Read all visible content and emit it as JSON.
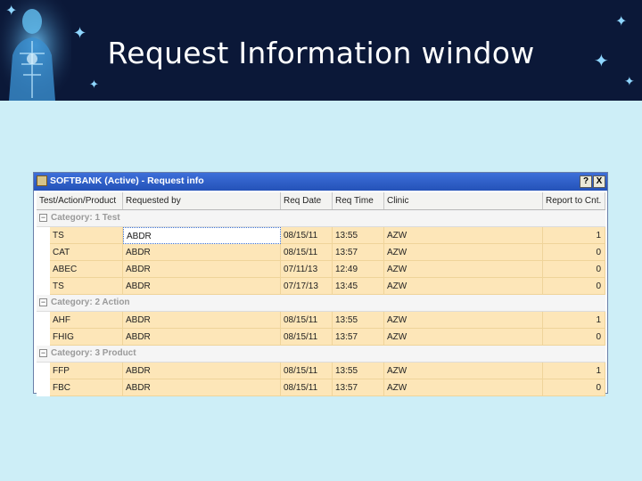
{
  "slide": {
    "title": "Request Information window"
  },
  "window": {
    "title": "SOFTBANK (Active) - Request info",
    "help_label": "?",
    "close_label": "X"
  },
  "table": {
    "columns": [
      "Test/Action/Product",
      "Requested by",
      "Req Date",
      "Req Time",
      "Clinic",
      "Report to Cnt."
    ],
    "groups": [
      {
        "label": "Category: 1 Test",
        "rows": [
          [
            "TS",
            "ABDR",
            "08/15/11",
            "13:55",
            "AZW",
            "1"
          ],
          [
            "CAT",
            "ABDR",
            "08/15/11",
            "13:57",
            "AZW",
            "0"
          ],
          [
            "ABEC",
            "ABDR",
            "07/11/13",
            "12:49",
            "AZW",
            "0"
          ],
          [
            "TS",
            "ABDR",
            "07/17/13",
            "13:45",
            "AZW",
            "0"
          ]
        ]
      },
      {
        "label": "Category: 2 Action",
        "rows": [
          [
            "AHF",
            "ABDR",
            "08/15/11",
            "13:55",
            "AZW",
            "1"
          ],
          [
            "FHIG",
            "ABDR",
            "08/15/11",
            "13:57",
            "AZW",
            "0"
          ]
        ]
      },
      {
        "label": "Category: 3 Product",
        "rows": [
          [
            "FFP",
            "ABDR",
            "08/15/11",
            "13:55",
            "AZW",
            "1"
          ],
          [
            "FBC",
            "ABDR",
            "08/15/11",
            "13:57",
            "AZW",
            "0"
          ]
        ]
      }
    ]
  },
  "colors": {
    "banner_bg": "#0b1838",
    "slide_bg": "#cdeef7",
    "row_bg": "#fde6b8",
    "titlebar": "#2f5fc9"
  }
}
